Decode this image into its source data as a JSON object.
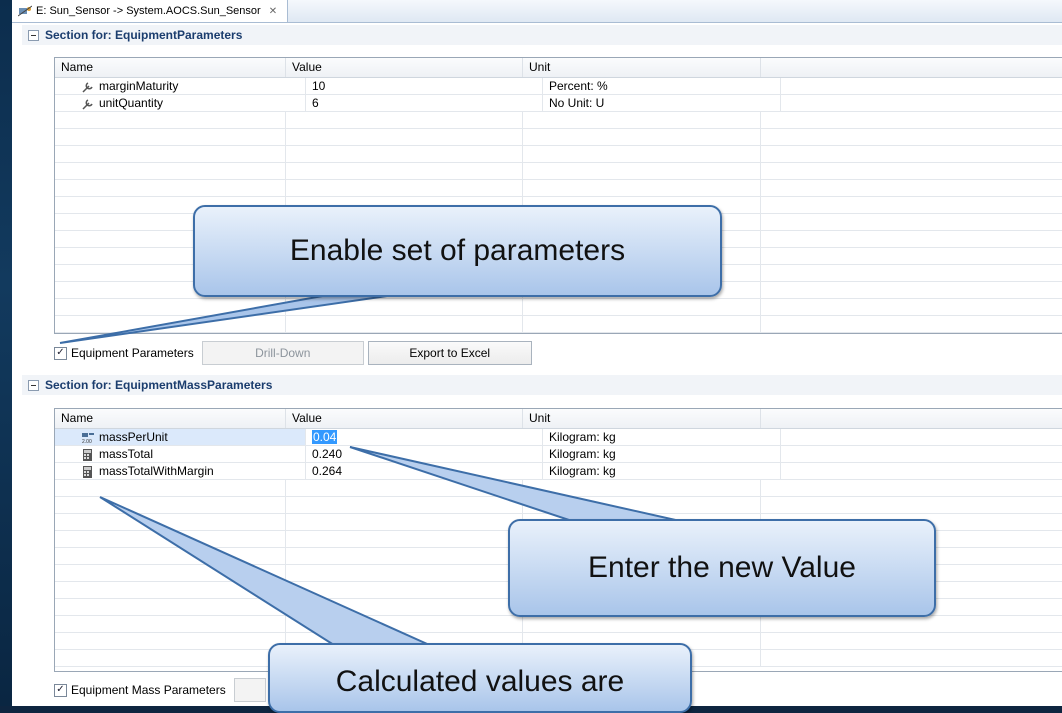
{
  "tab": {
    "title": "E: Sun_Sensor -> System.AOCS.Sun_Sensor",
    "close_glyph": "✕"
  },
  "section1": {
    "header": "Section for: EquipmentParameters",
    "columns": [
      "Name",
      "Value",
      "Unit"
    ],
    "rows": [
      {
        "icon": "wrench-icon",
        "name": "marginMaturity",
        "value": "10",
        "unit": "Percent: %"
      },
      {
        "icon": "wrench-icon",
        "name": "unitQuantity",
        "value": "6",
        "unit": "No Unit: U"
      }
    ],
    "checkbox_label": "Equipment Parameters",
    "checkbox_checked": true,
    "drill_down_label": "Drill-Down",
    "export_label": "Export to Excel"
  },
  "section2": {
    "header": "Section for: EquipmentMassParameters",
    "columns": [
      "Name",
      "Value",
      "Unit"
    ],
    "rows": [
      {
        "icon": "input-param-icon",
        "name": "massPerUnit",
        "value": "0.04",
        "unit": "Kilogram: kg",
        "selected": true
      },
      {
        "icon": "calculator-icon",
        "name": "massTotal",
        "value": "0.240",
        "unit": "Kilogram: kg"
      },
      {
        "icon": "calculator-icon",
        "name": "massTotalWithMargin",
        "value": "0.264",
        "unit": "Kilogram: kg"
      }
    ],
    "checkbox_label": "Equipment Mass Parameters",
    "checkbox_checked": true
  },
  "callouts": {
    "enable": "Enable set of parameters",
    "enter": "Enter the new Value",
    "calculated": "Calculated values are"
  },
  "colors": {
    "callout_border": "#3d6ea8",
    "selection": "#3399ff",
    "section_header_text": "#1b3d6e"
  }
}
